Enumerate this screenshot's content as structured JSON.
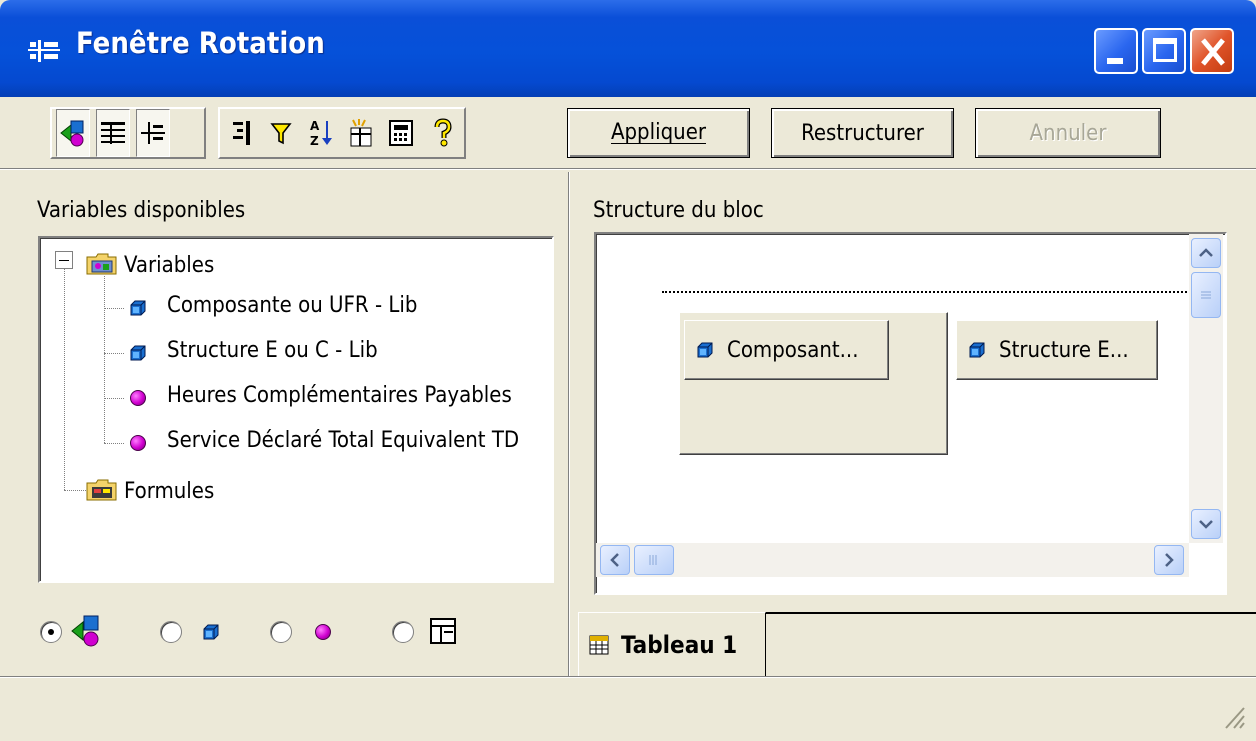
{
  "window": {
    "title": "Fenêtre Rotation",
    "title_icon": "rotation-icon",
    "controls": [
      "minimize",
      "maximize",
      "close"
    ]
  },
  "toolbar": {
    "icons": [
      "all-variables-icon",
      "table-icon",
      "pivot-icon",
      "sections-icon",
      "filter-icon",
      "sort-icon",
      "break-icon",
      "calculator-icon",
      "help-icon"
    ],
    "buttons": {
      "apply": "Appliquer",
      "restructure": "Restructurer",
      "cancel": "Annuler"
    }
  },
  "left_panel": {
    "label": "Variables disponibles",
    "tree": {
      "root_label": "Variables",
      "items": [
        {
          "label": "Composante ou UFR - Lib",
          "type": "dimension"
        },
        {
          "label": "Structure  E ou C - Lib",
          "type": "dimension"
        },
        {
          "label": "Heures Complémentaires Payables",
          "type": "indicator"
        },
        {
          "label": "Service Déclaré Total Equivalent TD",
          "type": "indicator"
        }
      ],
      "formulas_label": "Formules"
    },
    "filter_radios": [
      "all",
      "dimensions",
      "indicators",
      "formulas"
    ],
    "selected_filter": "all"
  },
  "right_panel": {
    "label": "Structure du bloc",
    "cells": {
      "row_cell": "Composant...",
      "column_cell": "Structure  E..."
    },
    "tab": "Tableau 1"
  },
  "colors": {
    "title_bar": "#0a4fd8",
    "face": "#ece9d8",
    "dimension": "#1a6fd0",
    "indicator": "#d000d0"
  }
}
